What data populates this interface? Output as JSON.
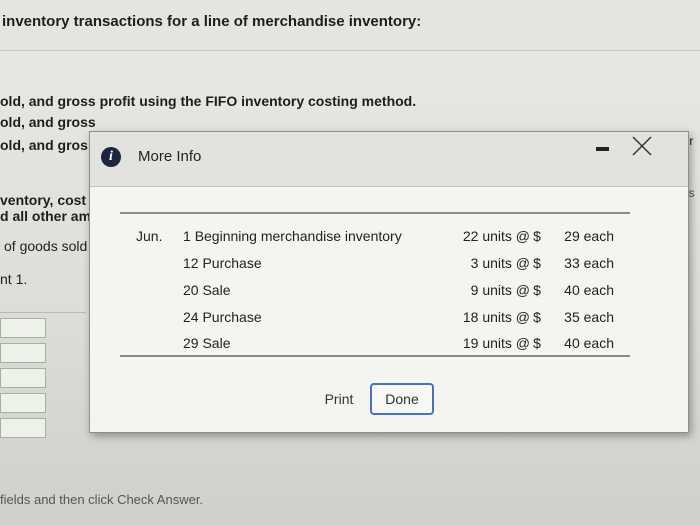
{
  "background": {
    "heading": "inventory transactions for a line of merchandise inventory:",
    "lines": [
      "old, and gross profit using the FIFO inventory costing method.",
      "old, and gross",
      "old, and gros",
      "ventory, cost",
      "d all other am",
      "of goods sold",
      "nt 1."
    ],
    "right_fragments": [
      "per",
      "cos"
    ],
    "footer": "fields and then click Check Answer."
  },
  "modal": {
    "title": "More Info",
    "icon": "info-icon",
    "month": "Jun.",
    "transactions": [
      {
        "day": "1",
        "description": "Beginning merchandise inventory",
        "units": "22 units @",
        "dollar": "$",
        "cost": "29 each"
      },
      {
        "day": "12",
        "description": "Purchase",
        "units": "3 units @",
        "dollar": "$",
        "cost": "33 each"
      },
      {
        "day": "20",
        "description": "Sale",
        "units": "9 units @",
        "dollar": "$",
        "cost": "40 each"
      },
      {
        "day": "24",
        "description": "Purchase",
        "units": "18 units @",
        "dollar": "$",
        "cost": "35 each"
      },
      {
        "day": "29",
        "description": "Sale",
        "units": "19 units @",
        "dollar": "$",
        "cost": "40 each"
      }
    ],
    "print_label": "Print",
    "done_label": "Done"
  },
  "colors": {
    "accent": "#4a72b8",
    "info_icon_bg": "#1d2540"
  }
}
